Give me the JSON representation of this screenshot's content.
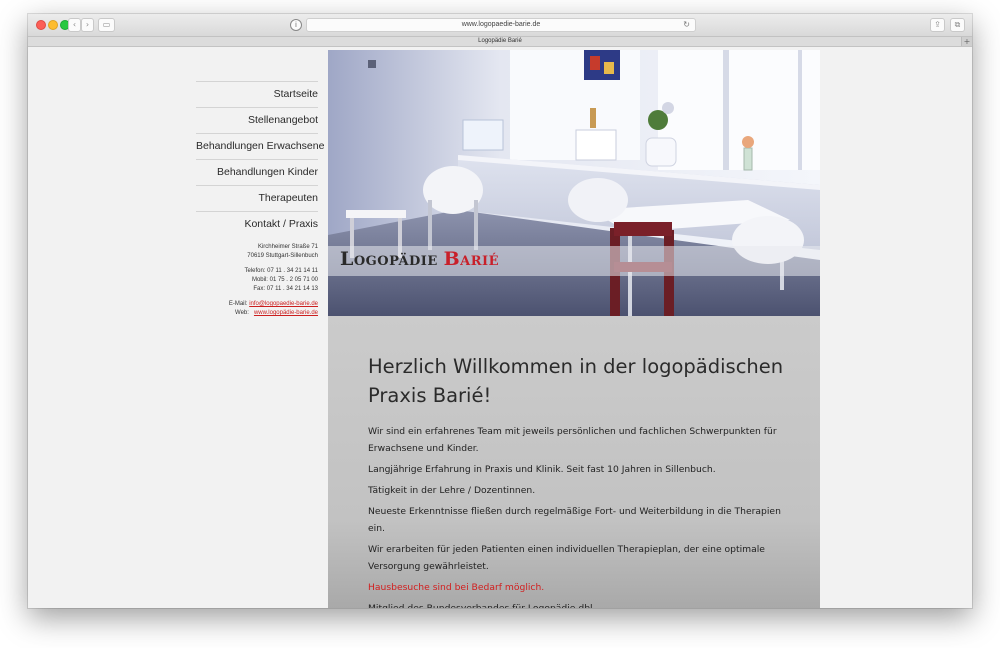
{
  "browser": {
    "url": "www.logopaedie-barie.de",
    "tab_title": "Logopädie Barié",
    "reload_icon": "reload-icon",
    "info_icon": "info-icon"
  },
  "sidebar": {
    "items": [
      {
        "label": "Startseite"
      },
      {
        "label": "Stellenangebot"
      },
      {
        "label": "Behandlungen Erwachsene"
      },
      {
        "label": "Behandlungen Kinder"
      },
      {
        "label": "Therapeuten"
      },
      {
        "label": "Kontakt / Praxis"
      }
    ],
    "address": {
      "street": "Kirchheimer Straße 71",
      "city": "70619 Stuttgart-Sillenbuch",
      "phone": "Telefon: 07 11 . 34 21 14 11",
      "mobile": "Mobil: 01 75 . 2 05 71 00",
      "fax": "Fax: 07 11 . 34 21 14 13",
      "email_label": "E-Mail:",
      "email": "info@logopaedie-barie.de",
      "web_label": "Web:",
      "web": "www.logopädie-barie.de"
    }
  },
  "hero": {
    "logo_part1": "Logopädie",
    "logo_part2": "Barié"
  },
  "main": {
    "heading": "Herzlich Willkommen in der logopädischen Praxis Barié!",
    "paragraphs": [
      "Wir sind ein erfahrenes Team mit jeweils persönlichen und fachlichen Schwerpunkten für Erwachsene und Kinder.",
      "Langjährige Erfahrung in Praxis und Klinik. Seit fast 10 Jahren in Sillenbuch.",
      "Tätigkeit in der Lehre / Dozentinnen.",
      "Neueste Erkenntnisse fließen durch regelmäßige Fort- und Weiterbildung in die Therapien ein.",
      "Wir erarbeiten für jeden Patienten einen individuellen Therapieplan, der eine optimale Versorgung gewährleistet.",
      "Hausbesuche sind bei Bedarf möglich.",
      "Mitglied des Bundesverbandes für Logopädie dbl."
    ]
  },
  "colors": {
    "accent_red": "#cc1f1f",
    "logo_red": "#c8202a",
    "content_bg": "#cbcbcb"
  }
}
